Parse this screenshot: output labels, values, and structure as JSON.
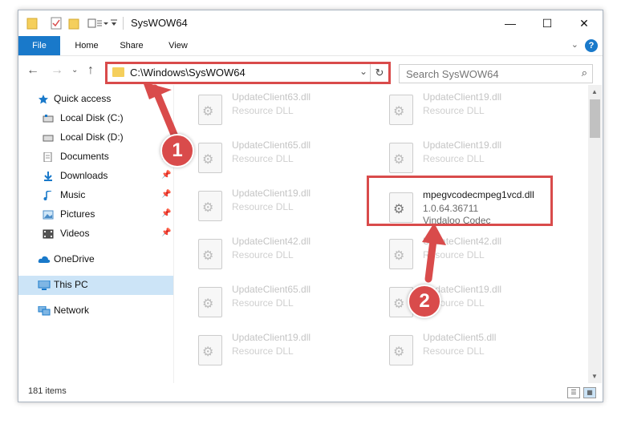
{
  "window": {
    "title": "SysWOW64",
    "minimize": "—",
    "maximize": "☐",
    "close": "✕"
  },
  "ribbon": {
    "tabs": [
      "File",
      "Home",
      "Share",
      "View"
    ],
    "collapse": "⌄",
    "help": "?"
  },
  "address": {
    "path": "C:\\Windows\\SysWOW64",
    "search_placeholder": "Search SysWOW64"
  },
  "nav": {
    "quick_access": "Quick access",
    "items": [
      {
        "label": "Local Disk (C:)",
        "icon": "drive-icon",
        "pinned": false
      },
      {
        "label": "Local Disk (D:)",
        "icon": "drive-icon",
        "pinned": false
      },
      {
        "label": "Documents",
        "icon": "documents-icon",
        "pinned": true
      },
      {
        "label": "Downloads",
        "icon": "downloads-icon",
        "pinned": true
      },
      {
        "label": "Music",
        "icon": "music-icon",
        "pinned": true
      },
      {
        "label": "Pictures",
        "icon": "pictures-icon",
        "pinned": true
      },
      {
        "label": "Videos",
        "icon": "videos-icon",
        "pinned": true
      }
    ],
    "onedrive": "OneDrive",
    "this_pc": "This PC",
    "network": "Network"
  },
  "files": {
    "left": [
      {
        "name": "UpdateClient63.dll",
        "desc": "Resource DLL"
      },
      {
        "name": "UpdateClient65.dll",
        "desc": "Resource DLL"
      },
      {
        "name": "UpdateClient19.dll",
        "desc": "Resource DLL"
      },
      {
        "name": "UpdateClient42.dll",
        "desc": "Resource DLL"
      },
      {
        "name": "UpdateClient65.dll",
        "desc": "Resource DLL"
      },
      {
        "name": "UpdateClient19.dll",
        "desc": "Resource DLL"
      }
    ],
    "right": [
      {
        "name": "UpdateClient19.dll",
        "desc": "Resource DLL"
      },
      {
        "name": "UpdateClient19.dll",
        "desc": "Resource DLL"
      },
      {
        "name": "UpdateClient42.dll",
        "desc": "Resource DLL"
      },
      {
        "name": "UpdateClient19.dll",
        "desc": "Resource DLL"
      },
      {
        "name": "UpdateClient5.dll",
        "desc": "Resource DLL"
      }
    ],
    "highlighted": {
      "name": "mpegvcodecmpeg1vcd.dll",
      "version": "1.0.64.36711",
      "company": "Vindaloo Codec"
    }
  },
  "status": {
    "count": "181 items"
  },
  "annotations": {
    "step1": "1",
    "step2": "2"
  },
  "colors": {
    "accent": "#1979ca",
    "highlight": "#d94b4b",
    "selected": "#cce4f7"
  }
}
